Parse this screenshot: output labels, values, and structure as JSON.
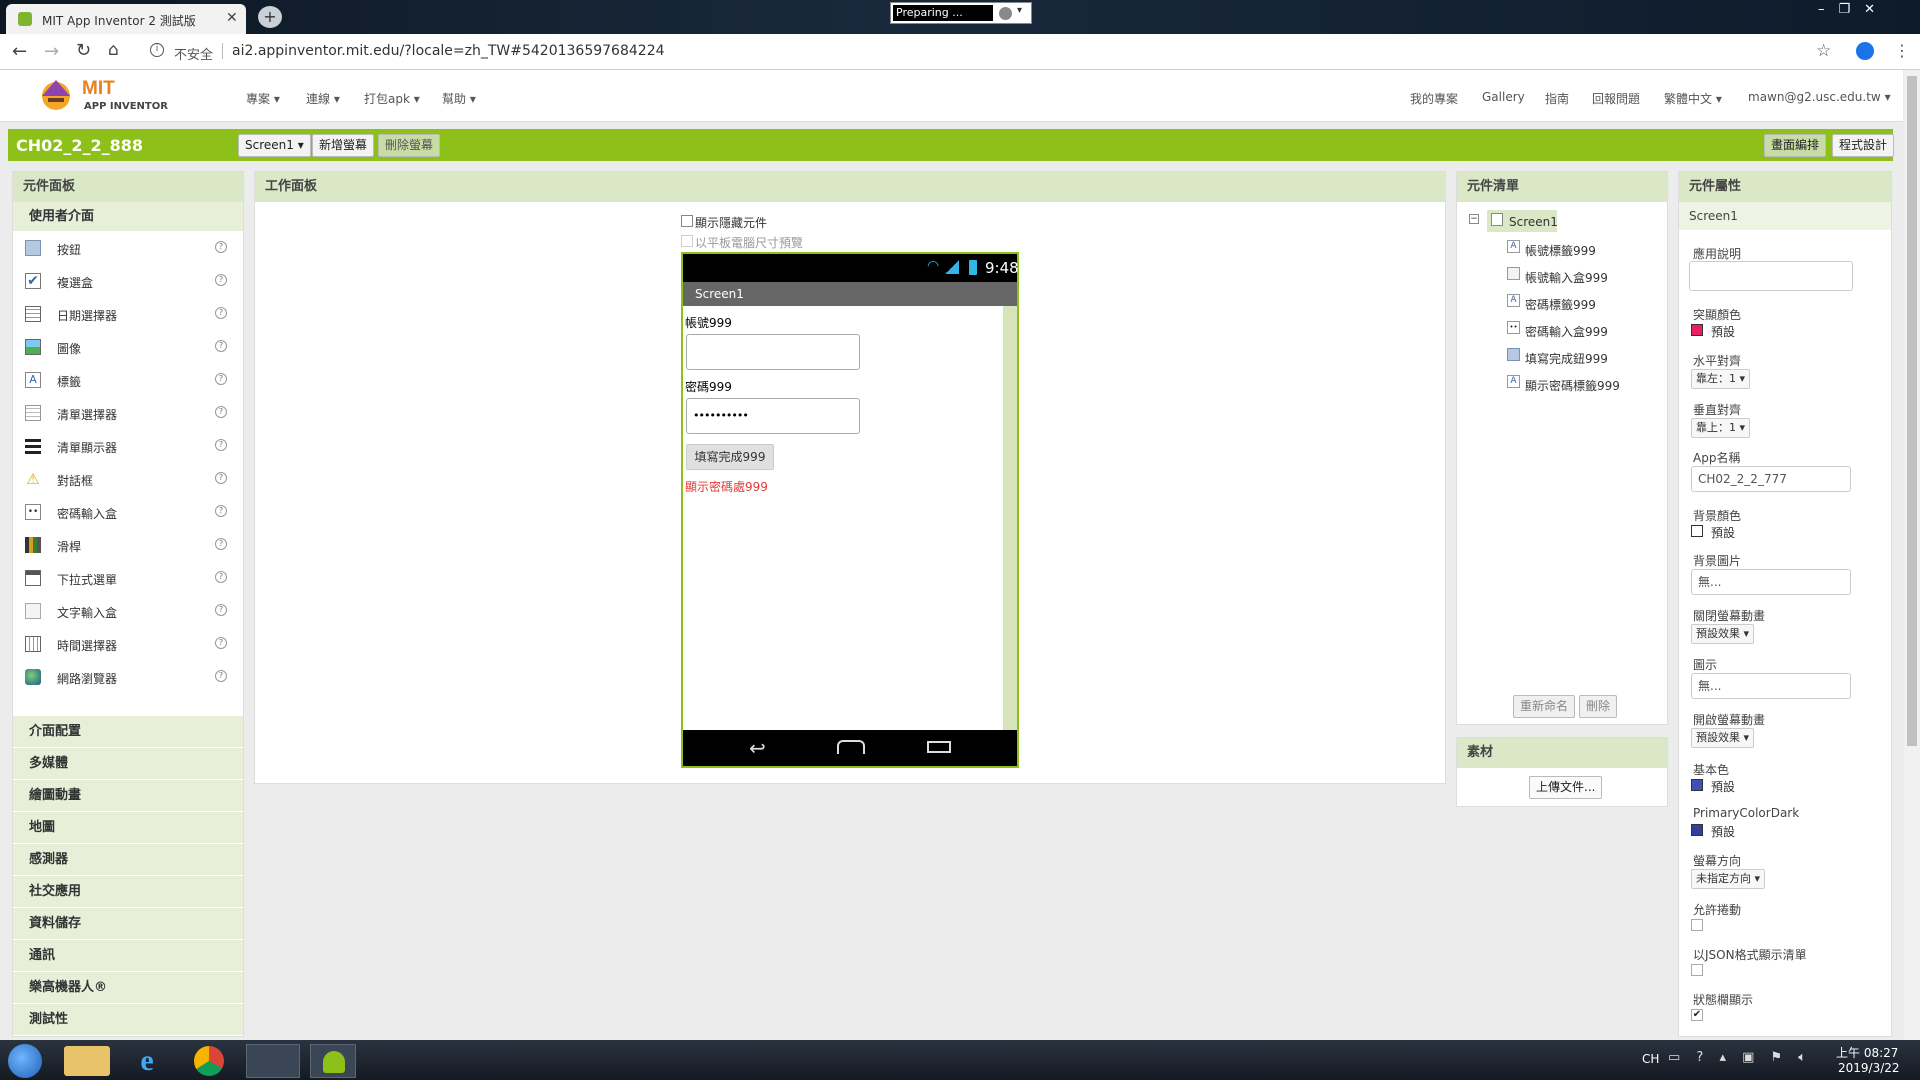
{
  "browser": {
    "tab_title": "MIT App Inventor 2 測試版",
    "url_security": "不安全",
    "url": "ai2.appinventor.mit.edu/?locale=zh_TW#5420136597684224",
    "extension_status": "Preparing ..."
  },
  "app_header": {
    "logo_mit": "MIT",
    "logo_app": "APP INVENTOR",
    "menus": [
      "專案",
      "連線",
      "打包apk",
      "幫助"
    ],
    "right_links": [
      "我的專案",
      "Gallery",
      "指南",
      "回報問題"
    ],
    "language": "繁體中文",
    "account": "mawn@g2.usc.edu.tw"
  },
  "project": {
    "name": "CH02_2_2_888",
    "screen_select": "Screen1",
    "add_screen": "新增螢幕",
    "remove_screen": "刪除螢幕",
    "designer": "畫面編排",
    "blocks": "程式設計"
  },
  "palette": {
    "title": "元件面板",
    "category_open": "使用者介面",
    "items": [
      {
        "label": "按鈕",
        "icon": "button-icon"
      },
      {
        "label": "複選盒",
        "icon": "checkbox-icon"
      },
      {
        "label": "日期選擇器",
        "icon": "datepicker-icon"
      },
      {
        "label": "圖像",
        "icon": "image-icon"
      },
      {
        "label": "標籤",
        "icon": "label-icon"
      },
      {
        "label": "清單選擇器",
        "icon": "listpicker-icon"
      },
      {
        "label": "清單顯示器",
        "icon": "listview-icon"
      },
      {
        "label": "對話框",
        "icon": "notifier-icon"
      },
      {
        "label": "密碼輸入盒",
        "icon": "passwordtextbox-icon"
      },
      {
        "label": "滑桿",
        "icon": "slider-icon"
      },
      {
        "label": "下拉式選單",
        "icon": "spinner-icon"
      },
      {
        "label": "文字輸入盒",
        "icon": "textbox-icon"
      },
      {
        "label": "時間選擇器",
        "icon": "timepicker-icon"
      },
      {
        "label": "網路瀏覽器",
        "icon": "webviewer-icon"
      }
    ],
    "categories": [
      "介面配置",
      "多媒體",
      "繪圖動畫",
      "地圖",
      "感測器",
      "社交應用",
      "資料儲存",
      "通訊",
      "樂高機器人®",
      "測試性"
    ]
  },
  "viewer": {
    "title": "工作面板",
    "show_hidden": "顯示隱藏元件",
    "tablet_preview": "以平板電腦尺寸預覽",
    "phone_time": "9:48",
    "screen_title": "Screen1",
    "label_account": "帳號999",
    "label_password": "密碼999",
    "password_value": "••••••••••",
    "done_button": "填寫完成999",
    "show_password_label": "顯示密碼處999"
  },
  "components": {
    "title": "元件清單",
    "root": "Screen1",
    "children": [
      "帳號標籤999",
      "帳號輸入盒999",
      "密碼標籤999",
      "密碼輸入盒999",
      "填寫完成鈕999",
      "顯示密碼標籤999"
    ],
    "rename": "重新命名",
    "delete": "刪除"
  },
  "media": {
    "title": "素材",
    "upload": "上傳文件..."
  },
  "properties": {
    "title": "元件屬性",
    "component": "Screen1",
    "about_label": "應用說明",
    "accent_color_label": "突顯顏色",
    "accent_color_value": "預設",
    "align_h_label": "水平對齊",
    "align_h_value": "靠左：1",
    "align_v_label": "垂直對齊",
    "align_v_value": "靠上：1",
    "app_name_label": "App名稱",
    "app_name_value": "CH02_2_2_777",
    "bg_color_label": "背景顏色",
    "bg_color_value": "預設",
    "bg_image_label": "背景圖片",
    "bg_image_value": "無...",
    "close_anim_label": "關閉螢幕動畫",
    "close_anim_value": "預設效果",
    "icon_label": "圖示",
    "icon_value": "無...",
    "open_anim_label": "開啟螢幕動畫",
    "open_anim_value": "預設效果",
    "primary_color_label": "基本色",
    "primary_color_value": "預設",
    "primary_dark_label": "PrimaryColorDark",
    "primary_dark_value": "預設",
    "orientation_label": "螢幕方向",
    "orientation_value": "未指定方向",
    "scrollable_label": "允許捲動",
    "json_label": "以JSON格式顯示清單",
    "statusbar_label": "狀態欄顯示"
  },
  "taskbar": {
    "lang": "CH",
    "time": "上午 08:27",
    "date": "2019/3/22"
  },
  "colors": {
    "green": "#8dc019",
    "accent": "#e91e63",
    "primary": "#3f51b5",
    "primary_dark": "#303f9f",
    "red_text": "#e53935"
  }
}
